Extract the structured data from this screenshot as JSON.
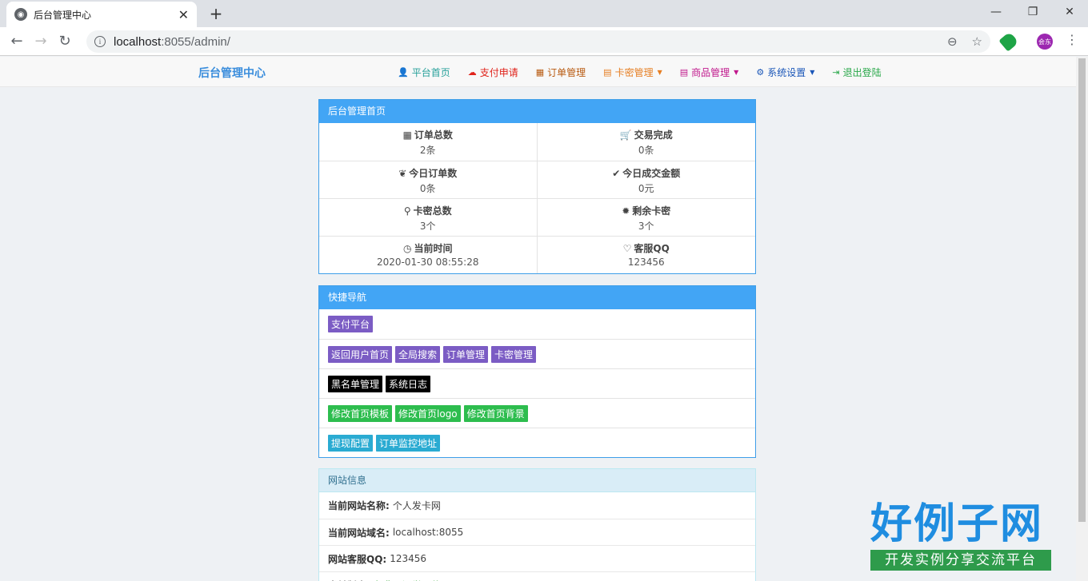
{
  "browser": {
    "tab_title": "后台管理中心",
    "url_host": "localhost",
    "url_rest": ":8055/admin/",
    "avatar_text": "会东"
  },
  "nav": {
    "brand": "后台管理中心",
    "items": [
      {
        "label": "平台首页",
        "icon": "user-icon",
        "glyph": "👤",
        "color": "#27a09a",
        "dropdown": false
      },
      {
        "label": "支付申请",
        "icon": "cloud-icon",
        "glyph": "☁",
        "color": "#e0221a",
        "dropdown": false
      },
      {
        "label": "订单管理",
        "icon": "calendar-icon",
        "glyph": "▦",
        "color": "#b85a10",
        "dropdown": false
      },
      {
        "label": "卡密管理",
        "icon": "list-icon",
        "glyph": "▤",
        "color": "#e67e22",
        "dropdown": true
      },
      {
        "label": "商品管理",
        "icon": "list-alt-icon",
        "glyph": "▤",
        "color": "#c0188c",
        "dropdown": true
      },
      {
        "label": "系统设置",
        "icon": "cog-icon",
        "glyph": "⚙",
        "color": "#1a56b8",
        "dropdown": true
      },
      {
        "label": "退出登陆",
        "icon": "logout-icon",
        "glyph": "⇥",
        "color": "#2aa84a",
        "dropdown": false
      }
    ]
  },
  "dashboard": {
    "title": "后台管理首页",
    "stats": [
      {
        "label": "订单总数",
        "value": "2条",
        "icon": "grid-icon",
        "glyph": "▦"
      },
      {
        "label": "交易完成",
        "value": "0条",
        "icon": "cart-icon",
        "glyph": "🛒"
      },
      {
        "label": "今日订单数",
        "value": "0条",
        "icon": "leaf-icon",
        "glyph": "❦"
      },
      {
        "label": "今日成交金额",
        "value": "0元",
        "icon": "check-icon",
        "glyph": "✔"
      },
      {
        "label": "卡密总数",
        "value": "3个",
        "icon": "pushpin-icon",
        "glyph": "⚲"
      },
      {
        "label": "剩余卡密",
        "value": "3个",
        "icon": "certificate-icon",
        "glyph": "✹"
      },
      {
        "label": "当前时间",
        "value": "2020-01-30 08:55:28",
        "icon": "clock-icon",
        "glyph": "◷"
      },
      {
        "label": "客服QQ",
        "value": "123456",
        "icon": "heart-icon",
        "glyph": "♡"
      }
    ]
  },
  "quicknav": {
    "title": "快捷导航",
    "rows": [
      [
        {
          "label": "支付平台",
          "color": "#7b5cc4"
        }
      ],
      [
        {
          "label": "返回用户首页",
          "color": "#7b5cc4"
        },
        {
          "label": "全局搜索",
          "color": "#7b5cc4"
        },
        {
          "label": "订单管理",
          "color": "#7b5cc4"
        },
        {
          "label": "卡密管理",
          "color": "#7b5cc4"
        }
      ],
      [
        {
          "label": "黑名单管理",
          "color": "#000000"
        },
        {
          "label": "系统日志",
          "color": "#000000"
        }
      ],
      [
        {
          "label": "修改首页模板",
          "color": "#2dbd4e"
        },
        {
          "label": "修改首页logo",
          "color": "#2dbd4e"
        },
        {
          "label": "修改首页背景",
          "color": "#2dbd4e"
        }
      ],
      [
        {
          "label": "提现配置",
          "color": "#2aabd2"
        },
        {
          "label": "订单监控地址",
          "color": "#2aabd2"
        }
      ]
    ]
  },
  "siteinfo": {
    "title": "网站信息",
    "rows": [
      {
        "key": "当前网站名称:",
        "value": "个人发卡网"
      },
      {
        "key": "当前网站域名:",
        "value": "localhost:8055"
      },
      {
        "key": "网站客服QQ:",
        "value": "123456"
      },
      {
        "key": "当前版本:",
        "value": "免费开源学习使用"
      }
    ]
  },
  "watermark": {
    "title": "好例子网",
    "subtitle": "开发实例分享交流平台"
  }
}
